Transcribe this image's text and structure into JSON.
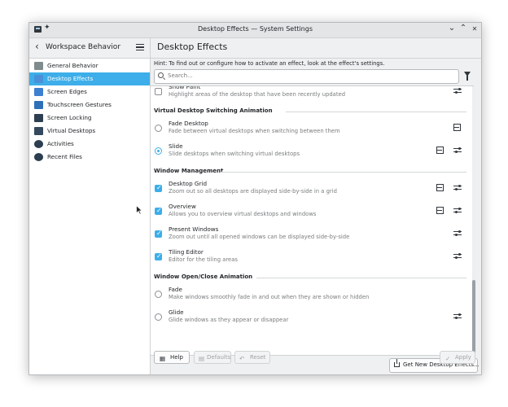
{
  "window": {
    "title": "Desktop Effects — System Settings"
  },
  "titlebar": {
    "minimize_glyph": "⌄",
    "maximize_glyph": "⌃",
    "close_glyph": "✕",
    "pin_glyph": "📌"
  },
  "sidebar": {
    "back_label": "Workspace Behavior",
    "items": [
      {
        "label": "General Behavior",
        "icon": "general-behavior-icon",
        "color": "#7f8c8d",
        "active": false
      },
      {
        "label": "Desktop Effects",
        "icon": "desktop-effects-icon",
        "color": "#4a90d9",
        "active": true
      },
      {
        "label": "Screen Edges",
        "icon": "screen-edges-icon",
        "color": "#3d7fd1",
        "active": false
      },
      {
        "label": "Touchscreen Gestures",
        "icon": "touchscreen-icon",
        "color": "#2f6fb8",
        "active": false
      },
      {
        "label": "Screen Locking",
        "icon": "screen-locking-icon",
        "color": "#2c3e50",
        "active": false
      },
      {
        "label": "Virtual Desktops",
        "icon": "virtual-desktops-icon",
        "color": "#34495e",
        "active": false
      },
      {
        "label": "Activities",
        "icon": "activities-icon",
        "color": "#2c3e50",
        "active": false
      },
      {
        "label": "Recent Files",
        "icon": "recent-files-icon",
        "color": "#2c3e50",
        "active": false
      }
    ]
  },
  "main": {
    "title": "Desktop Effects",
    "hint": "Hint: To find out or configure how to activate an effect, look at the effect's settings.",
    "search_placeholder": "Search..."
  },
  "list": {
    "partial_item": {
      "title": "Show Paint",
      "description": "Highlight areas of the desktop that have been recently updated"
    },
    "sections": [
      {
        "title": "Virtual Desktop Switching Animation",
        "items": [
          {
            "title": "Fade Desktop",
            "description": "Fade between virtual desktops when switching between them",
            "control": "radio",
            "checked": false,
            "video": true,
            "configure": false
          },
          {
            "title": "Slide",
            "description": "Slide desktops when switching virtual desktops",
            "control": "radio",
            "checked": true,
            "video": true,
            "configure": true
          }
        ]
      },
      {
        "title": "Window Management",
        "items": [
          {
            "title": "Desktop Grid",
            "description": "Zoom out so all desktops are displayed side-by-side in a grid",
            "control": "checkbox",
            "checked": true,
            "video": true,
            "configure": true
          },
          {
            "title": "Overview",
            "description": "Allows you to overview virtual desktops and windows",
            "control": "checkbox",
            "checked": true,
            "video": true,
            "configure": true
          },
          {
            "title": "Present Windows",
            "description": "Zoom out until all opened windows can be displayed side-by-side",
            "control": "checkbox",
            "checked": true,
            "video": false,
            "configure": true
          },
          {
            "title": "Tiling Editor",
            "description": "Editor for the tiling areas",
            "control": "checkbox",
            "checked": true,
            "video": false,
            "configure": true
          }
        ]
      },
      {
        "title": "Window Open/Close Animation",
        "items": [
          {
            "title": "Fade",
            "description": "Make windows smoothly fade in and out when they are shown or hidden",
            "control": "radio",
            "checked": false,
            "video": false,
            "configure": false
          },
          {
            "title": "Glide",
            "description": "Glide windows as they appear or disappear",
            "control": "radio",
            "checked": false,
            "video": false,
            "configure": true
          }
        ]
      }
    ]
  },
  "buttons": {
    "get_new": "Get New Desktop Effects...",
    "help": "Help",
    "defaults": "Defaults",
    "reset": "Reset",
    "apply": "Apply"
  },
  "colors": {
    "accent": "#3daee9"
  }
}
